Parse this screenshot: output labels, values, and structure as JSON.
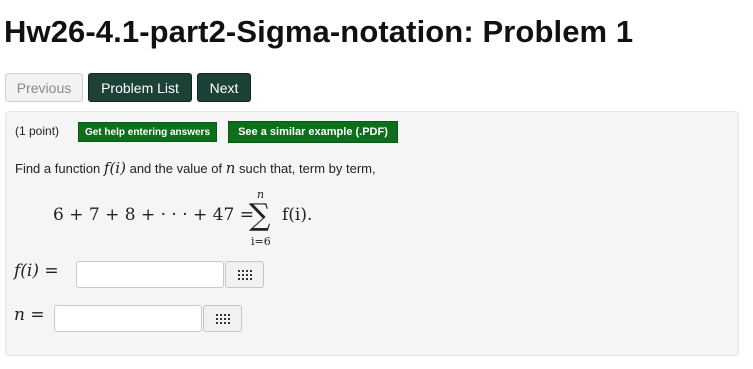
{
  "page": {
    "title": "Hw26-4.1-part2-Sigma-notation: Problem 1"
  },
  "nav": {
    "previous": "Previous",
    "problem_list": "Problem List",
    "next": "Next"
  },
  "problem": {
    "points": "(1 point)",
    "help_button": "Get help entering answers",
    "example_button": "See a similar example (.PDF)",
    "prompt_find": "Find a function",
    "prompt_fi": "f(i)",
    "prompt_and": "and the value of",
    "prompt_n": "n",
    "prompt_rest": "such that, term by term,",
    "equation": {
      "lhs": "6 + 7 + 8 + · · · + 47 =",
      "sigma": "∑",
      "upper": "n",
      "lower": "i=6",
      "rhs": "f(i)."
    },
    "answers": [
      {
        "label": "f(i) =",
        "value": ""
      },
      {
        "label": "n =",
        "value": ""
      }
    ]
  },
  "icons": {
    "equation_editor": "matrix-grid-icon"
  },
  "colors": {
    "nav_button": "#1c4237",
    "help_button": "#0d6e1c",
    "panel": "#f5f5f5"
  }
}
